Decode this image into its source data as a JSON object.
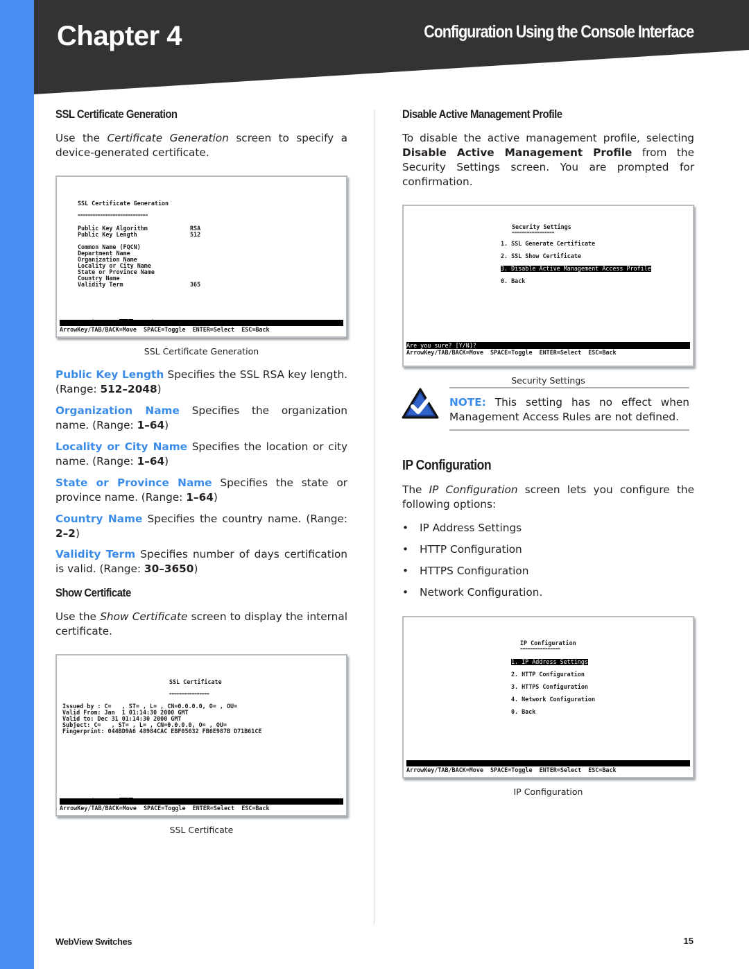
{
  "header": {
    "chapter": "Chapter 4",
    "title": "Configuration Using the Console Interface",
    "bg_color": "#333333",
    "sidebar_color": "#4a8df0"
  },
  "left": {
    "ssl_gen": {
      "heading": "SSL Certificate Generation",
      "intro_pre": "Use the ",
      "intro_em": "Certificate Generation",
      "intro_post": " screen to specify a device-generated certificate.",
      "caption": "SSL Certificate Generation",
      "screen": {
        "title": "SSL Certificate Generation",
        "underline": "============================",
        "rows": [
          {
            "label": "Public Key Algorithm",
            "value": "RSA"
          },
          {
            "label": "Public Key Length",
            "value": "512"
          },
          {
            "label": "Common Name (FQCN)",
            "value": ""
          },
          {
            "label": "Department Name",
            "value": ""
          },
          {
            "label": "Organization Name",
            "value": ""
          },
          {
            "label": "Locality or City Name",
            "value": ""
          },
          {
            "label": "State or Province Name",
            "value": ""
          },
          {
            "label": "Country Name",
            "value": ""
          },
          {
            "label": "Validity Term",
            "value": "365"
          }
        ],
        "action_label": "Action->",
        "actions": [
          "Quit",
          "Edit",
          "Execute"
        ],
        "help": "ArrowKey/TAB/BACK=Move  SPACE=Toggle  ENTER=Select  ESC=Back"
      }
    },
    "definitions": [
      {
        "term": "Public Key Length",
        "desc": " Specifies the SSL RSA key length. (Range: ",
        "range": "512–2048",
        "end": ")"
      },
      {
        "term": "Organization Name",
        "desc": " Specifies the organization name. (Range: ",
        "range": "1–64",
        "end": ")"
      },
      {
        "term": "Locality or City Name",
        "desc": "  Specifies the location or city name. (Range: ",
        "range": "1–64",
        "end": ")"
      },
      {
        "term": "State or Province Name",
        "desc": "  Specifies the state or province name. (Range: ",
        "range": "1–64",
        "end": ")"
      },
      {
        "term": "Country Name",
        "desc": "  Specifies the country name. (Range: ",
        "range": "2–2",
        "end": ")"
      },
      {
        "term": "Validity Term",
        "desc": "  Specifies number of days certification is valid. (Range: ",
        "range": "30–3650",
        "end": ")"
      }
    ],
    "show_cert": {
      "heading": "Show Certificate",
      "intro_pre": "Use the ",
      "intro_em": "Show Certificate",
      "intro_post": " screen to display the internal certificate.",
      "caption": "SSL Certificate",
      "screen": {
        "title": "SSL Certificate",
        "underline": "================",
        "lines": [
          "Issued by : C=   , ST= , L= , CN=0.0.0.0, O= , OU=",
          "Valid From: Jan  1 01:14:30 2000 GMT",
          "Valid to: Dec 31 01:14:30 2000 GMT",
          "Subject: C=   , ST= , L= , CN=0.0.0.0, O= , OU=",
          "Fingerprint: 044BD9A6 48984CAC EBF05632 FB6E987B D71B61CE"
        ],
        "action_label": "Action->",
        "actions": [
          "Quit",
          "Refresh"
        ],
        "help": "ArrowKey/TAB/BACK=Move  SPACE=Toggle  ENTER=Select  ESC=Back"
      }
    }
  },
  "right": {
    "disable": {
      "heading": "Disable Active Management Profile",
      "p_pre": "To disable the active management profile, selecting ",
      "p_bold": "Disable Active Management Profile",
      "p_post": " from the Security Settings screen. You are prompted for confirmation.",
      "caption": "Security Settings",
      "screen": {
        "title": "Security Settings",
        "underline": "=================",
        "items": [
          "1. SSL Generate Certificate",
          "2. SSL Show Certificate",
          "3. Disable Active Management Access Profile",
          "0. Back"
        ],
        "selected_index": 2,
        "prompt": "Are you sure? [Y/N]?",
        "help": "ArrowKey/TAB/BACK=Move  SPACE=Toggle  ENTER=Select  ESC=Back"
      }
    },
    "note": {
      "label": "NOTE:",
      "text": " This setting has no effect when Management Access Rules are not defined.",
      "icon": "checkmark-icon"
    },
    "ip": {
      "heading": "IP Configuration",
      "p_pre": "The ",
      "p_em": "IP Configuration",
      "p_post": " screen lets you configure the following options:",
      "bullets": [
        "IP Address Settings",
        "HTTP Configuration",
        "HTTPS Configuration",
        "Network Configuration."
      ],
      "caption": "IP Configuration",
      "screen": {
        "title": "IP Configuration",
        "underline": "================",
        "items": [
          "1. IP Address Settings",
          "2. HTTP Configuration",
          "3. HTTPS Configuration",
          "4. Network Configuration",
          "0. Back"
        ],
        "selected_index": 0,
        "help": "ArrowKey/TAB/BACK=Move  SPACE=Toggle  ENTER=Select  ESC=Back"
      }
    }
  },
  "footer": {
    "product": "WebView Switches",
    "page": "15"
  }
}
